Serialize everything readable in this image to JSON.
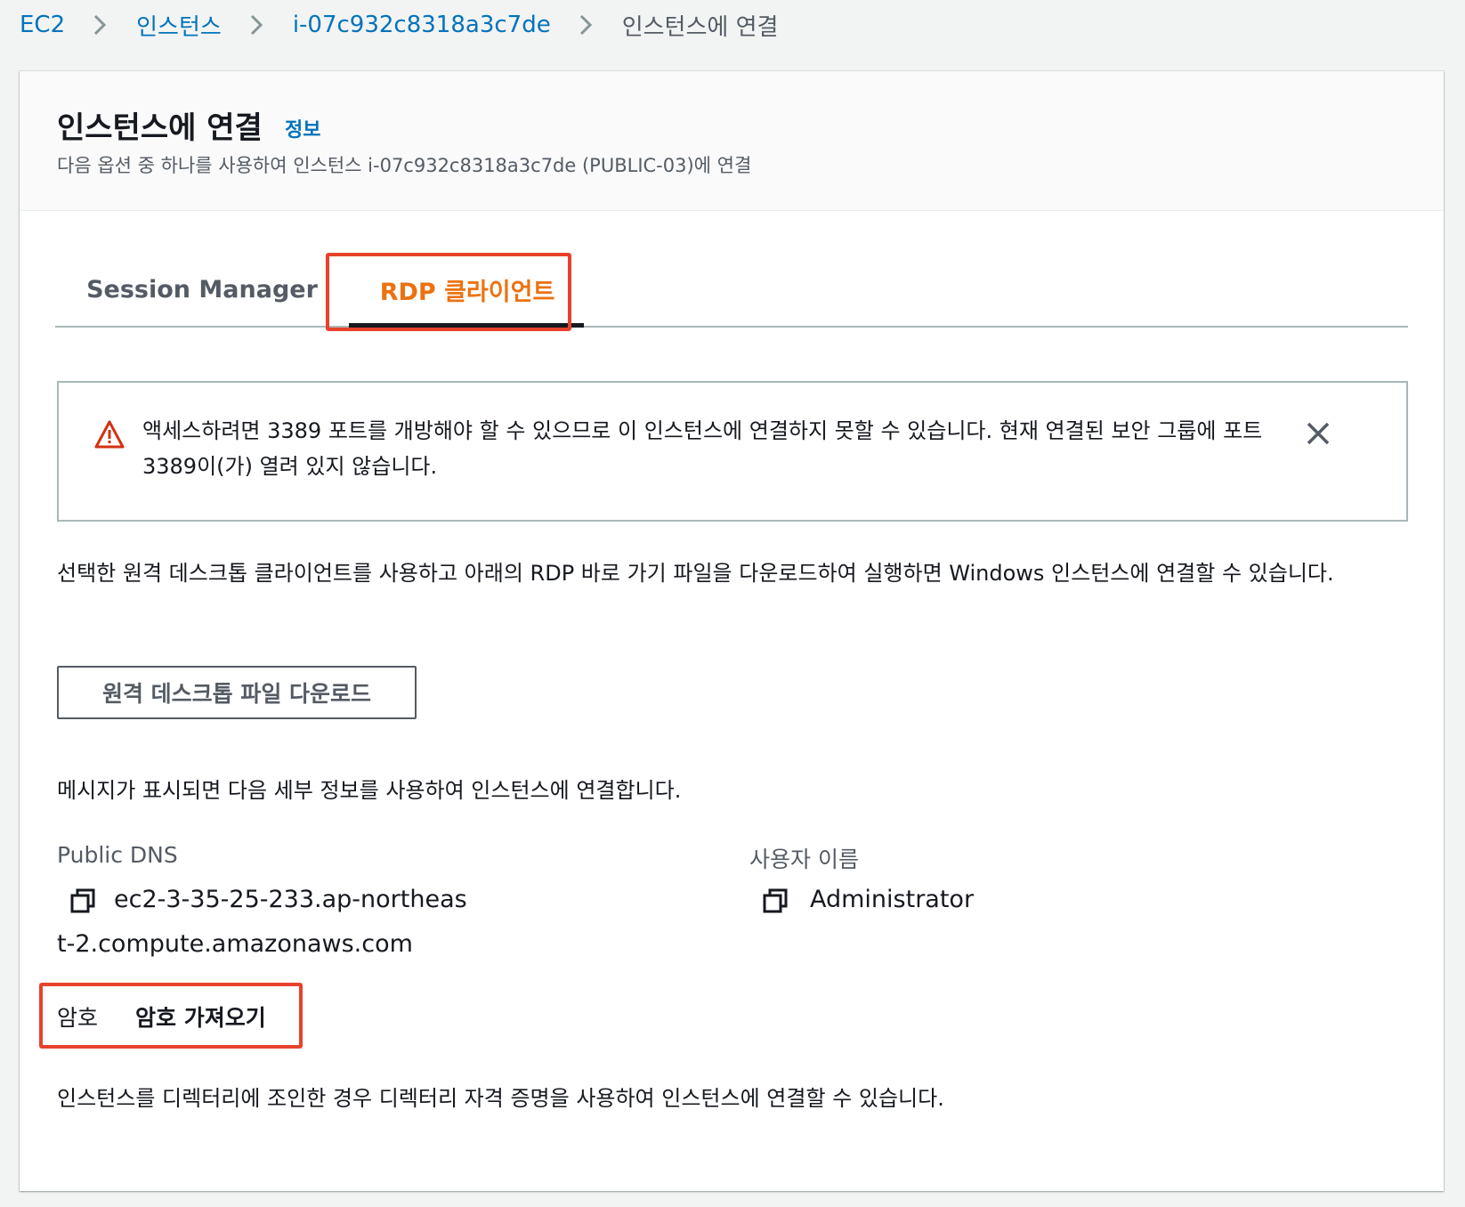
{
  "breadcrumb": {
    "items": [
      "EC2",
      "인스턴스",
      "i-07c932c8318a3c7de"
    ],
    "current": "인스턴스에 연결"
  },
  "header": {
    "title": "인스턴스에 연결",
    "info_link": "정보",
    "description": "다음 옵션 중 하나를 사용하여 인스턴스 i-07c932c8318a3c7de (PUBLIC-03)에 연결"
  },
  "tabs": [
    {
      "label": "Session Manager",
      "selected": false
    },
    {
      "label": "RDP 클라이언트",
      "selected": true
    }
  ],
  "alert": {
    "icon": "warning-icon",
    "message": "액세스하려면 3389 포트를 개방해야 할 수 있으므로 이 인스턴스에 연결하지 못할 수 있습니다. 현재 연결된 보안 그룹에 포트 3389이(가) 열려 있지 않습니다.",
    "close_icon": "close-icon"
  },
  "rdp": {
    "description": "선택한 원격 데스크톱 클라이언트를 사용하고 아래의 RDP 바로 가기 파일을 다운로드하여 실행하면 Windows 인스턴스에 연결할 수 있습니다.",
    "download_button": "원격 데스크톱 파일 다운로드",
    "prompt_text": "메시지가 표시되면 다음 세부 정보를 사용하여 인스턴스에 연결합니다.",
    "public_dns_label": "Public DNS",
    "public_dns_value": "ec2-3-35-25-233.ap-northeast-2.compute.amazonaws.com",
    "username_label": "사용자 이름",
    "username_value": "Administrator",
    "password_label": "암호",
    "password_link": "암호 가져오기",
    "directory_text": "인스턴스를 디렉터리에 조인한 경우 디렉터리 자격 증명을 사용하여 인스턴스에 연결할 수 있습니다."
  },
  "colors": {
    "link": "#0073bb",
    "selected_tab": "#ec7211",
    "highlight": "#e8412c",
    "warning": "#d13212"
  }
}
